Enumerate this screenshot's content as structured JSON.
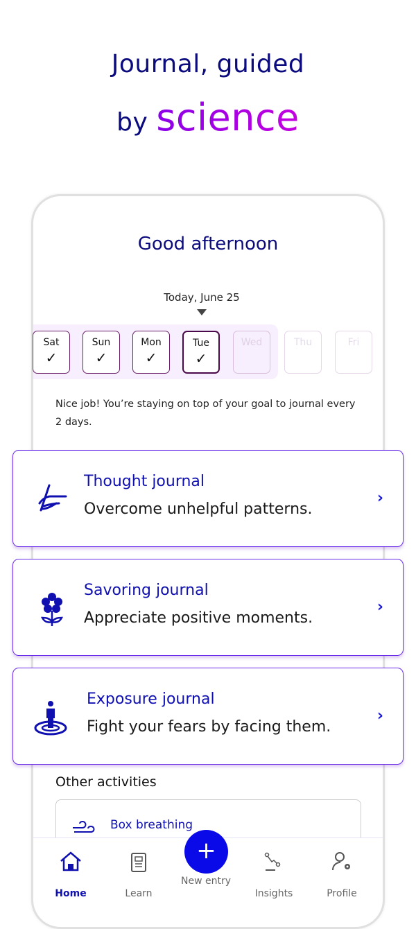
{
  "hero": {
    "line1": "Journal, guided",
    "line2_prefix": "by",
    "line2_highlight": "science"
  },
  "greeting": "Good afternoon",
  "date_label": "Today, June 25",
  "days": [
    {
      "label": "Sat",
      "done": true
    },
    {
      "label": "Sun",
      "done": true
    },
    {
      "label": "Mon",
      "done": true
    },
    {
      "label": "Tue",
      "done": true,
      "selected": true
    },
    {
      "label": "Wed",
      "done": false
    },
    {
      "label": "Thu",
      "done": false
    },
    {
      "label": "Fri",
      "done": false
    }
  ],
  "check_glyph": "✓",
  "goal_message": "Nice job! You’re staying on top of your goal to journal every 2 days.",
  "journals": [
    {
      "title": "Thought journal",
      "subtitle": "Overcome unhelpful patterns.",
      "icon": "hand-writing-icon"
    },
    {
      "title": "Savoring journal",
      "subtitle": "Appreciate positive moments.",
      "icon": "flower-icon"
    },
    {
      "title": "Exposure journal",
      "subtitle": "Fight your fears by facing them.",
      "icon": "person-target-icon"
    }
  ],
  "other_activities": {
    "heading": "Other activities",
    "items": [
      {
        "title": "Box breathing",
        "icon": "wind-icon"
      }
    ]
  },
  "nav": {
    "items": [
      {
        "label": "Home",
        "active": true
      },
      {
        "label": "Learn"
      },
      {
        "label": "New entry"
      },
      {
        "label": "Insights"
      },
      {
        "label": "Profile"
      }
    ],
    "fab_glyph": "+"
  },
  "colors": {
    "primary": "#0a0ae8",
    "title": "#0b0b7e",
    "accent_gradient": [
      "#8a00e8",
      "#c400e0"
    ],
    "card_border": "#6a2de8"
  }
}
